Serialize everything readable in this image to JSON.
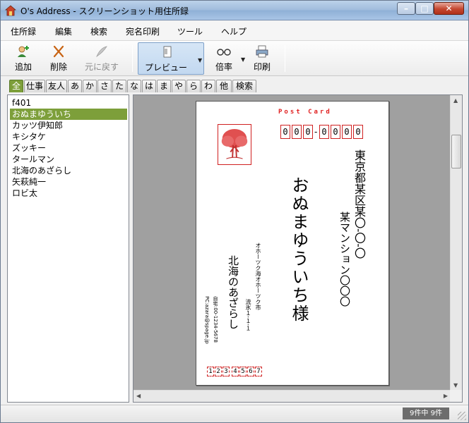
{
  "window": {
    "title": "O's Address - スクリーンショット用住所録",
    "min_glyph": "–",
    "max_glyph": "□",
    "close_glyph": "✕"
  },
  "menu": [
    "住所録",
    "編集",
    "検索",
    "宛名印刷",
    "ツール",
    "ヘルプ"
  ],
  "toolbar": {
    "add_label": "追加",
    "delete_label": "削除",
    "undo_label": "元に戻す",
    "preview_label": "プレビュー",
    "zoom_label": "倍率",
    "print_label": "印刷"
  },
  "tabs": [
    "全",
    "仕事",
    "友人",
    "あ",
    "か",
    "さ",
    "た",
    "な",
    "は",
    "ま",
    "や",
    "ら",
    "わ",
    "他",
    "検索"
  ],
  "active_tab": "全",
  "list": [
    "f401",
    "おぬまゆういち",
    "カッツ伊知郎",
    "キシタケ",
    "ズッキー",
    "タールマン",
    "北海のあざらし",
    "矢萩純一",
    "ロビ太"
  ],
  "selected_index": 1,
  "postcard": {
    "header": "Post Card",
    "zip": [
      "0",
      "0",
      "0",
      "0",
      "0",
      "0",
      "0"
    ],
    "recipient_address1": "東京都某区某〇-〇-〇",
    "recipient_address2": "某マンション〇〇〇",
    "recipient_name": "おぬまゆういち様",
    "sender_address1": "オホーツク海オホーツク市",
    "sender_address2": "流氷１-１-１",
    "sender_name": "北海のあざらし",
    "sender_tel": "自宅:00-1234-5678",
    "sender_pc": "PC:azara@spage.jp",
    "sender_zip": [
      "1",
      "2",
      "3",
      "4",
      "5",
      "6",
      "7"
    ]
  },
  "status": {
    "count": "9件中 9件"
  },
  "colors": {
    "accent_green": "#7d9f3a",
    "postal_red": "#d02020"
  }
}
